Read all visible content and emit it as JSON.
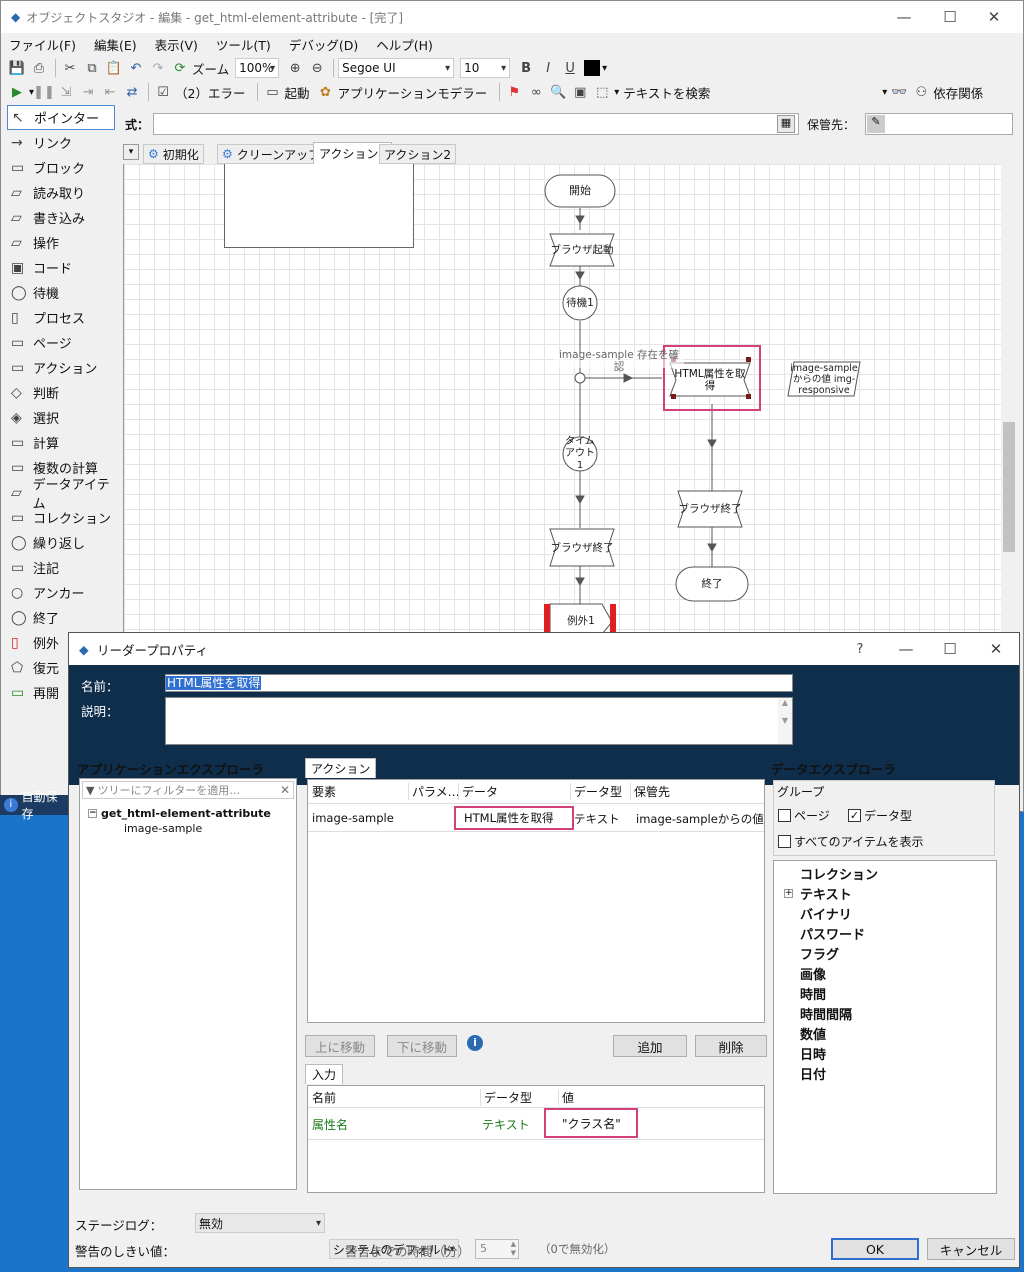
{
  "window": {
    "title": "オブジェクトスタジオ - 編集 - get_html-element-attribute - [完了]"
  },
  "menu": [
    "ファイル(F)",
    "編集(E)",
    "表示(V)",
    "ツール(T)",
    "デバッグ(D)",
    "ヘルプ(H)"
  ],
  "toolbar1": {
    "zoom_label": "ズーム",
    "zoom_value": "100%",
    "font": "Segoe UI",
    "size": "10",
    "bold": "B",
    "italic": "I",
    "underline": "U"
  },
  "toolbar2": {
    "error_label": "（2）エラー",
    "start_label": "起動",
    "app_modeller": "アプリケーションモデラー",
    "search_text": "テキストを検索",
    "dependency": "依存関係"
  },
  "exprbar": {
    "label": "式：",
    "store_label": "保管先："
  },
  "tabs": [
    "初期化",
    "クリーンアップ",
    "アクション1",
    "アクション2"
  ],
  "toolbox": [
    "ポインター",
    "リンク",
    "ブロック",
    "読み取り",
    "書き込み",
    "操作",
    "コード",
    "待機",
    "プロセス",
    "ページ",
    "アクション",
    "判断",
    "選択",
    "計算",
    "複数の計算",
    "データアイテム",
    "コレクション",
    "繰り返し",
    "注記",
    "アンカー",
    "終了",
    "例外",
    "復元",
    "再開"
  ],
  "flow": {
    "start": "開始",
    "browser_start": "ブラウザ起動",
    "wait": "待機1",
    "check_label": "image-sample 存在を確認",
    "reader": "HTML属性を取得",
    "data_item": "image-sample からの値 img-responsive",
    "timeout": "タイムアウト1",
    "browser_end_left": "ブラウザ終了",
    "browser_end_right": "ブラウザ終了",
    "end": "終了",
    "exception": "例外1"
  },
  "statusbar": {
    "autosave": "自動保存"
  },
  "dialog": {
    "title": "リーダープロパティ",
    "help": "?",
    "name_label": "名前：",
    "name_value": "HTML属性を取得",
    "desc_label": "説明：",
    "app_explorer": {
      "title": "アプリケーションエクスプローラ",
      "filter_placeholder": "ツリーにフィルターを適用…",
      "root": "get_html-element-attribute",
      "child": "image-sample"
    },
    "action_tab": "アクション",
    "action_cols": [
      "要素",
      "パラメ…",
      "データ",
      "データ型",
      "保管先"
    ],
    "action_row": {
      "element": "image-sample",
      "param": "",
      "data": "HTML属性を取得",
      "type": "テキスト",
      "store": "image-sampleからの値"
    },
    "buttons": {
      "up": "上に移動",
      "down": "下に移動",
      "add": "追加",
      "delete": "削除",
      "ok": "OK",
      "cancel": "キャンセル"
    },
    "input_tab": "入力",
    "input_cols": [
      "名前",
      "データ型",
      "値"
    ],
    "input_row": {
      "name": "属性名",
      "type": "テキスト",
      "value": "\"クラス名\""
    },
    "data_explorer": {
      "title": "データエクスプローラ",
      "group": "グループ",
      "page": "ページ",
      "datatype": "データ型",
      "show_all": "すべてのアイテムを表示",
      "items": [
        "コレクション",
        "テキスト",
        "バイナリ",
        "パスワード",
        "フラグ",
        "画像",
        "時間",
        "時間間隔",
        "数値",
        "日時",
        "日付"
      ]
    },
    "stage_log_label": "ステージログ：",
    "stage_log_value": "無効",
    "warn_label": "警告のしきい値：",
    "warn_value": "システムのデフォルト",
    "warn_time_label": "警告までの時間（分）",
    "warn_time_value": "5",
    "warn_time_note": "（0で無効化）"
  }
}
